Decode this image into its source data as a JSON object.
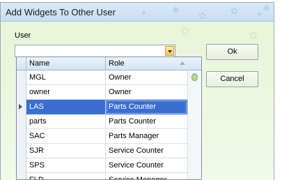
{
  "dialog": {
    "title": "Add Widgets To Other User",
    "user_label": "User",
    "user_value": "",
    "ok_label": "Ok",
    "cancel_label": "Cancel"
  },
  "grid": {
    "columns": [
      "Name",
      "Role"
    ],
    "selected_row_index": 2,
    "rows": [
      {
        "name": "MGL",
        "role": "Owner"
      },
      {
        "name": "owner",
        "role": "Owner"
      },
      {
        "name": "LAS",
        "role": "Parts Counter"
      },
      {
        "name": "parts",
        "role": "Parts Counter"
      },
      {
        "name": "SAC",
        "role": "Parts Manager"
      },
      {
        "name": "SJR",
        "role": "Service Counter"
      },
      {
        "name": "SPS",
        "role": "Service Counter"
      },
      {
        "name": "FLD",
        "role": "Service Manager"
      }
    ]
  },
  "icons": {
    "dropdown": "chevron-down-icon",
    "scroll_up": "scroll-up-icon",
    "sort": "sort-ascending-icon",
    "row_pointer": "current-row-arrow-icon"
  },
  "colors": {
    "title_bar": "#cfe3f3",
    "dialog_background": "#ecf7e0",
    "selection": "#3a6fd1",
    "dropdown_button": "#f5c466"
  }
}
